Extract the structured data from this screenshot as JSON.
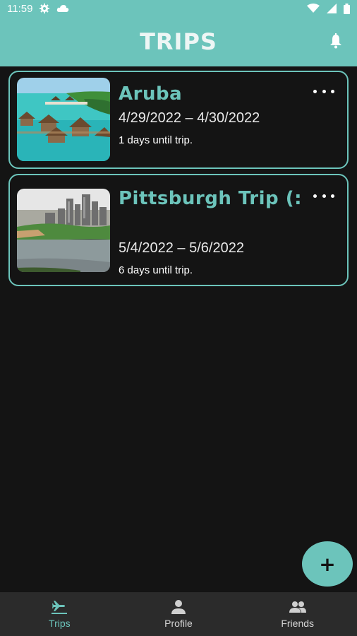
{
  "status_bar": {
    "time": "11:59",
    "icons": [
      "gear-icon",
      "cloud-icon",
      "wifi-icon",
      "signal-icon",
      "battery-icon"
    ]
  },
  "app_bar": {
    "title": "TRIPS",
    "notification_icon": "bell-icon"
  },
  "trips": [
    {
      "name": "Aruba",
      "dates": "4/29/2022 – 4/30/2022",
      "countdown": "1 days until trip.",
      "thumbnail": "aruba-overwater-bungalows-photo"
    },
    {
      "name": "Pittsburgh Trip (:",
      "dates": "5/4/2022 – 5/6/2022",
      "countdown": "6 days until trip.",
      "thumbnail": "pittsburgh-skyline-photo"
    }
  ],
  "fab": {
    "label": "+",
    "icon": "plus-icon"
  },
  "bottom_nav": {
    "items": [
      {
        "label": "Trips",
        "icon": "airplane-icon",
        "active": true
      },
      {
        "label": "Profile",
        "icon": "person-icon",
        "active": false
      },
      {
        "label": "Friends",
        "icon": "people-icon",
        "active": false
      }
    ]
  },
  "colors": {
    "accent": "#6cc4bb",
    "background": "#141414",
    "nav_background": "#2b2b2b"
  }
}
